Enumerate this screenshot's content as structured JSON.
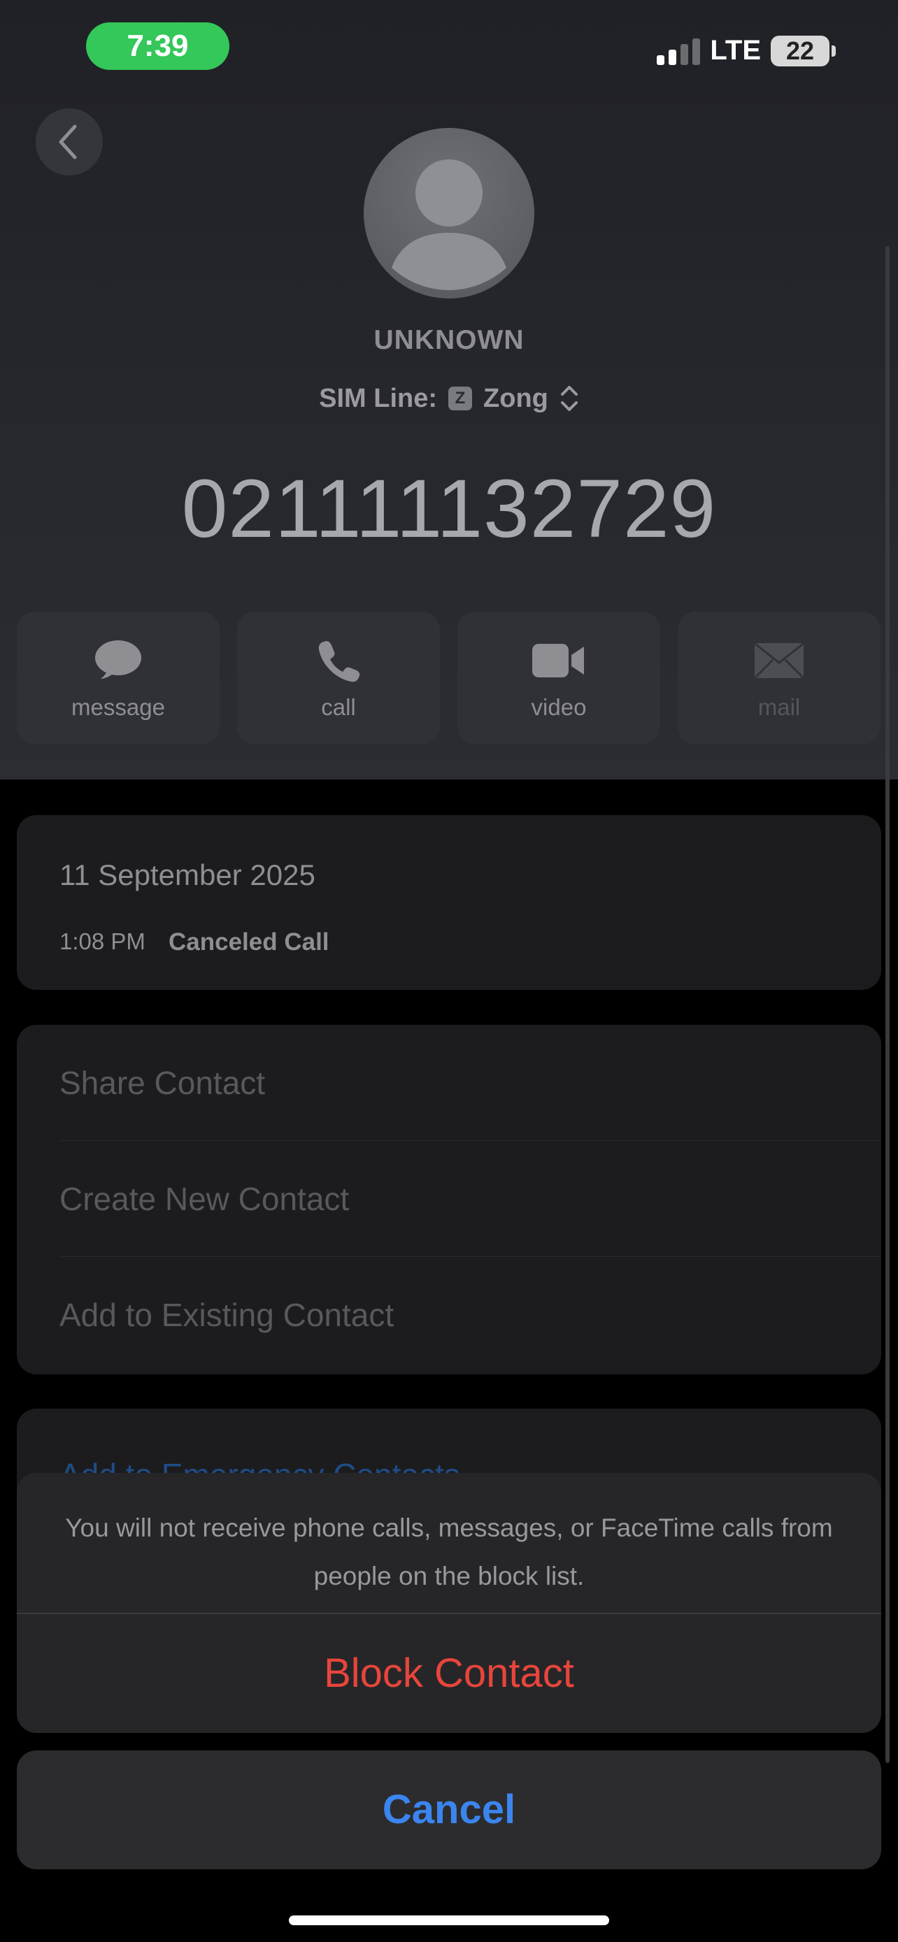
{
  "status_bar": {
    "time": "7:39",
    "network": "LTE",
    "battery": "22"
  },
  "contact": {
    "name": "UNKNOWN",
    "sim_label": "SIM Line:",
    "sim_badge": "Z",
    "sim_carrier": "Zong",
    "phone_number": "021111132729"
  },
  "actions": [
    {
      "label": "message",
      "icon": "message-bubble-icon",
      "enabled": true
    },
    {
      "label": "call",
      "icon": "phone-icon",
      "enabled": true
    },
    {
      "label": "video",
      "icon": "video-camera-icon",
      "enabled": true
    },
    {
      "label": "mail",
      "icon": "envelope-icon",
      "enabled": false
    }
  ],
  "call_history": {
    "date": "11 September 2025",
    "time": "1:08 PM",
    "status": "Canceled Call"
  },
  "contact_options": [
    "Share Contact",
    "Create New Contact",
    "Add to Existing Contact"
  ],
  "emergency": {
    "label": "Add to Emergency Contacts"
  },
  "action_sheet": {
    "message": "You will not receive phone calls, messages, or FaceTime calls from people on the block list.",
    "block_label": "Block Contact",
    "cancel_label": "Cancel"
  },
  "colors": {
    "status_time_bg": "#34c759",
    "destructive": "#e8453c",
    "accent": "#3b85f0"
  }
}
